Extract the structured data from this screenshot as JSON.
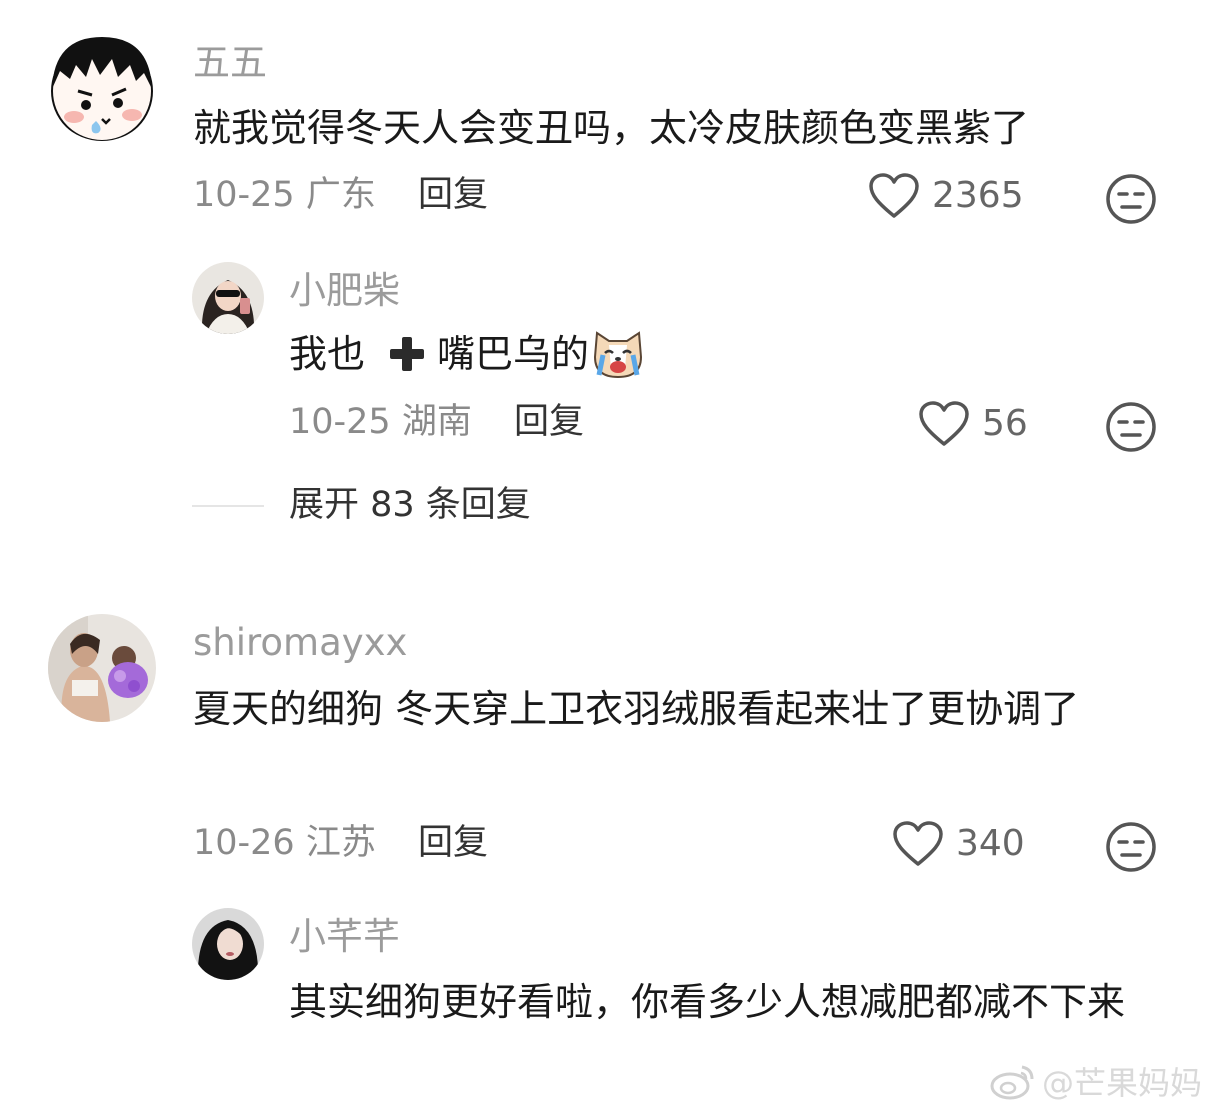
{
  "comments": [
    {
      "username": "五五",
      "text": "就我觉得冬天人会变丑吗，太冷皮肤颜色变黑紫了",
      "date": "10-25",
      "location": "广东",
      "reply_label": "回复",
      "likes": "2365",
      "replies": [
        {
          "username": "小肥柴",
          "text_before": "我也",
          "text_after": "嘴巴乌的",
          "emoji": "crying-dog-emoji",
          "date": "10-25",
          "location": "湖南",
          "reply_label": "回复",
          "likes": "56"
        }
      ],
      "expand_label": "展开 83 条回复"
    },
    {
      "username": "shiromayxx",
      "text": "夏天的细狗 冬天穿上卫衣羽绒服看起来壮了更协调了",
      "date": "10-26",
      "location": "江苏",
      "reply_label": "回复",
      "likes": "340",
      "replies": [
        {
          "username": "小芊芊",
          "text": "其实细狗更好看啦，你看多少人想减肥都减不下来"
        }
      ]
    }
  ],
  "watermark": "@芒果妈妈",
  "icons": {
    "like": "heart-outline-icon",
    "dislike": "neutral-face-icon",
    "plus": "plus-icon",
    "watermark": "weibo-icon"
  },
  "colors": {
    "username": "#9b9b9b",
    "text": "#1a1a1a",
    "meta": "#8a8a8a",
    "icon": "#555555"
  }
}
